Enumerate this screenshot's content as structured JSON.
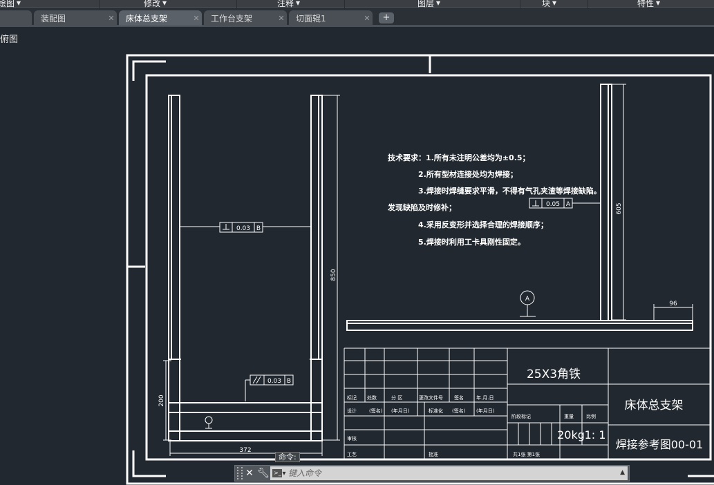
{
  "ribbon": {
    "panels": [
      "绘图",
      "修改",
      "注释",
      "图层",
      "块",
      "特性"
    ]
  },
  "tabs": [
    {
      "label": ""
    },
    {
      "label": "装配图"
    },
    {
      "label": "床体总支架"
    },
    {
      "label": "工作台支架"
    },
    {
      "label": "切面辊1"
    }
  ],
  "viewport": {
    "label": "俯图"
  },
  "drawing": {
    "dim_850": "850",
    "dim_605": "605",
    "dim_372": "372",
    "dim_200": "200",
    "dim_96": "96",
    "tol_1_value": "0.03",
    "tol_1_datum": "B",
    "tol_2_value": "0.05",
    "tol_2_datum": "A",
    "tol_3_value": "0.03",
    "tol_3_datum": "B",
    "datum_a": "A",
    "notes": [
      "技术要求：1.所有未注明公差均为±0.5；",
      "2.所有型材连接处均为焊接；",
      "3.焊接时焊缝要求平滑，不得有气孔夹渣等焊接缺陷。",
      "发现缺陷及时修补；",
      "4.采用反变形并选择合理的焊接顺序；",
      "5.焊接时利用工卡具刚性固定。"
    ],
    "title_block": {
      "material": "25X3角铁",
      "part_name": "床体总支架",
      "drawing_no": "焊接参考图00-01",
      "weight": "20kg",
      "scale": "1: 1",
      "h_mark": "标记",
      "h_count": "处数",
      "h_zone": "分 区",
      "h_change": "更改文件号",
      "h_sign": "签名",
      "h_date": "年.月.日",
      "h_design": "设计",
      "h_sig1": "(签名)",
      "h_date1": "(年月日)",
      "h_std": "标准化",
      "h_sig2": "(签名)",
      "h_date2": "(年月日)",
      "h_stage": "阶段标记",
      "h_weight": "重量",
      "h_scale": "比例",
      "h_review": "审核",
      "h_process": "工艺",
      "h_approve": "批准",
      "h_sheets": "共1张 第1张"
    }
  },
  "command": {
    "label": "命令:",
    "placeholder": "键入命令"
  }
}
